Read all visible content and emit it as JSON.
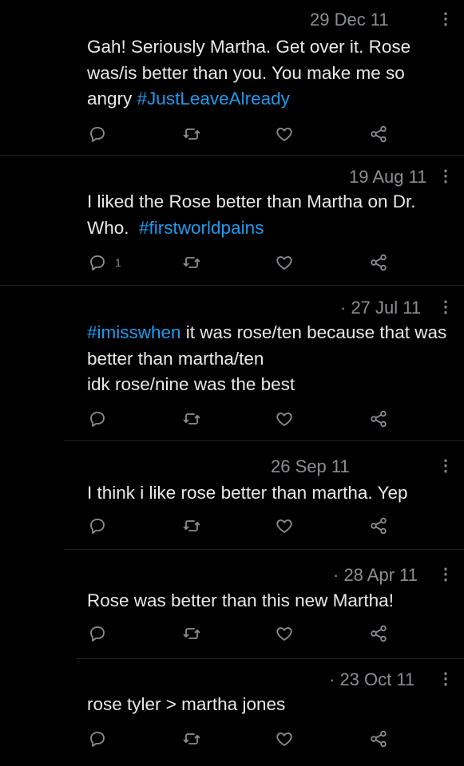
{
  "tweets": [
    {
      "date": "29 Dec 11",
      "text_parts": [
        "Gah! Seriously Martha. Get over it. Rose was/is better than you. You make me so angry "
      ],
      "hashtag": "#JustLeaveAlready",
      "reply_count": ""
    },
    {
      "date": "19 Aug 11",
      "text_parts": [
        "I liked the Rose better than Martha on Dr. Who.  "
      ],
      "hashtag": "#firstworldpains",
      "reply_count": "1"
    },
    {
      "date": "· 27 Jul 11",
      "lead_hashtag": "#imisswhen",
      "text_parts": [
        " it was rose/ten because that was better than martha/ten\nidk rose/nine was the best"
      ],
      "reply_count": ""
    },
    {
      "date": "26 Sep 11",
      "text_parts": [
        "I think i like rose better than martha. Yep"
      ],
      "reply_count": ""
    },
    {
      "date": "· 28 Apr 11",
      "text_parts": [
        "Rose was better than this new Martha!"
      ],
      "reply_count": ""
    },
    {
      "date": "· 23 Oct 11",
      "text_parts": [
        "rose tyler > martha jones"
      ],
      "reply_count": ""
    }
  ],
  "icons": {
    "reply": "reply-icon",
    "retweet": "retweet-icon",
    "like": "heart-icon",
    "share": "share-icon",
    "more": "more-vertical-icon"
  },
  "colors": {
    "background": "#000000",
    "text": "#e7e9ea",
    "muted": "#8b8f94",
    "hashtag": "#1d9bf0"
  }
}
